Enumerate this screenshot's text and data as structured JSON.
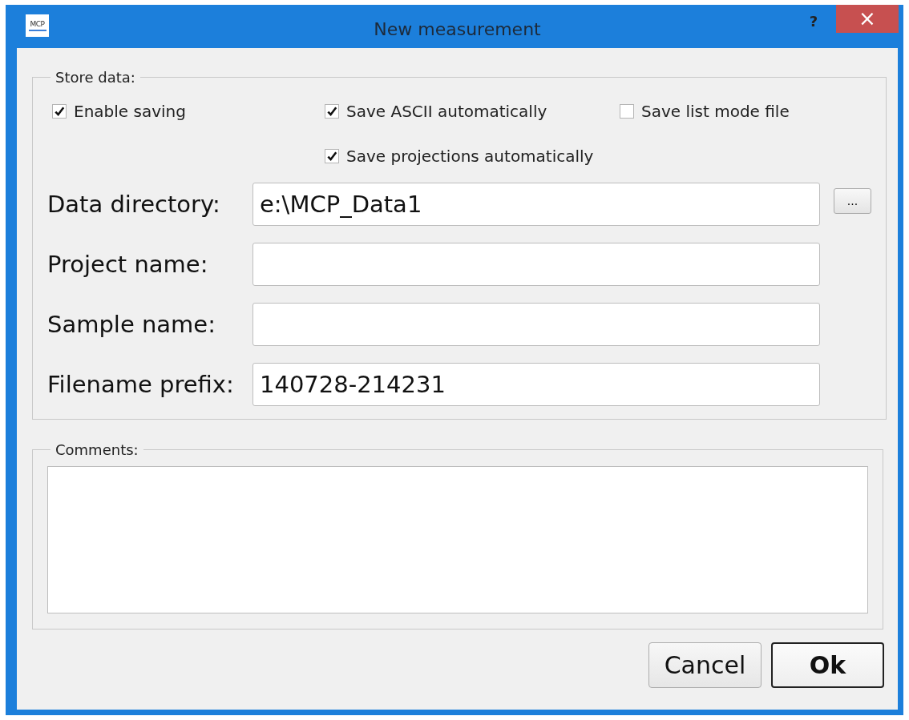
{
  "window": {
    "title": "New measurement",
    "icon_text": "MCP",
    "help": "?",
    "close": "×"
  },
  "store_data": {
    "title": "Store data:",
    "options": [
      {
        "label": "Enable saving",
        "checked": true
      },
      {
        "label": "Save ASCII automatically",
        "checked": true
      },
      {
        "label": "Save list mode file",
        "checked": false
      },
      {
        "label": "Save projections automatically",
        "checked": true
      }
    ],
    "fields": [
      {
        "label": "Data directory:",
        "value": "e:\\MCP_Data1",
        "browse": "..."
      },
      {
        "label": "Project name:"
      },
      {
        "label": "Sample name:"
      },
      {
        "label": "Filename prefix:",
        "value": "140728-214231"
      }
    ]
  },
  "comments": {
    "title": "Comments:"
  },
  "buttons": [
    {
      "label": "Cancel",
      "default": false
    },
    {
      "label": "Ok",
      "default": true
    }
  ]
}
